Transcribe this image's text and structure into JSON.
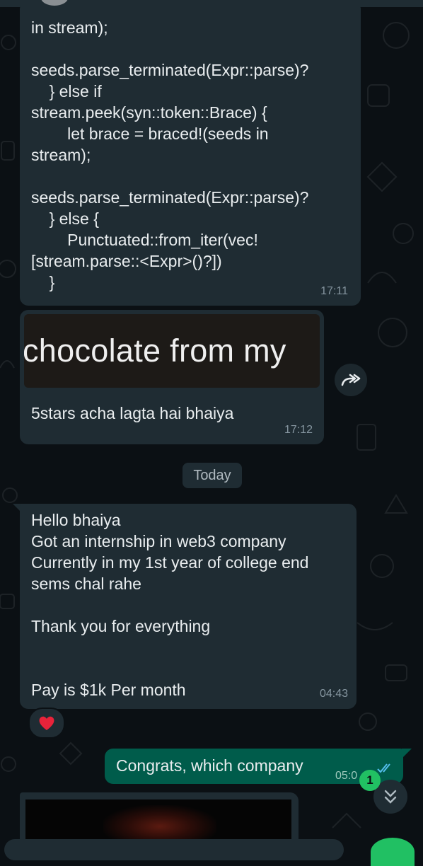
{
  "chat": {
    "code_message": {
      "text": "in stream);\n\nseeds.parse_terminated(Expr::parse)?\n    } else if\nstream.peek(syn::token::Brace) {\n        let brace = braced!(seeds in\nstream);\n\nseeds.parse_terminated(Expr::parse)?\n    } else {\n        Punctuated::from_iter(vec!\n[stream.parse::<Expr>()?])\n    }",
      "time": "17:11"
    },
    "image_message": {
      "image_text": "chocolate from my",
      "caption": "5stars acha lagta hai bhaiya",
      "time": "17:12",
      "forward_icon": "forward-icon"
    },
    "date_divider": "Today",
    "incoming_message": {
      "text": "Hello bhaiya\nGot an internship in web3 company\nCurrently in my 1st year of college end\nsems chal rahe\n\nThank you for everything\n\n\nPay is $1k Per month",
      "time": "04:43",
      "reaction": "heart-emoji"
    },
    "outgoing_message": {
      "text": "Congrats, which company",
      "time": "05:0",
      "status": "double-check-icon"
    },
    "scroll_down": {
      "unread_count": "1",
      "icon": "double-chevron-down-icon"
    }
  },
  "colors": {
    "background": "#0b1014",
    "incoming_bubble": "#1f2c33",
    "outgoing_bubble": "#005c4b",
    "accent": "#21c063",
    "read_tick": "#53bdeb"
  }
}
